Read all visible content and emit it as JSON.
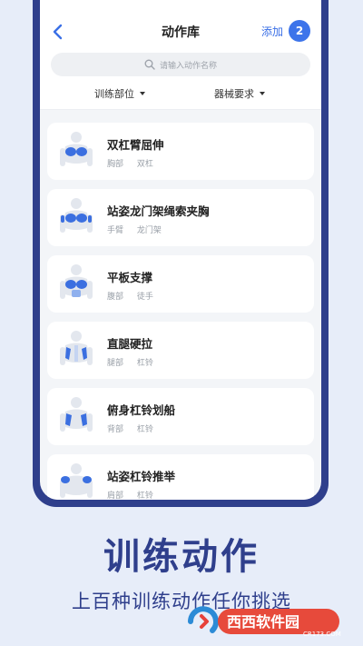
{
  "header": {
    "title": "动作库",
    "add_label": "添加",
    "badge_count": "2"
  },
  "search": {
    "placeholder": "请输入动作名称"
  },
  "filters": [
    {
      "label": "训练部位"
    },
    {
      "label": "器械要求"
    }
  ],
  "exercises": [
    {
      "name": "双杠臂屈伸",
      "tags": [
        "胸部",
        "双杠"
      ]
    },
    {
      "name": "站姿龙门架绳索夹胸",
      "tags": [
        "手臂",
        "龙门架"
      ]
    },
    {
      "name": "平板支撑",
      "tags": [
        "腹部",
        "徒手"
      ]
    },
    {
      "name": "直腿硬拉",
      "tags": [
        "腿部",
        "杠铃"
      ]
    },
    {
      "name": "俯身杠铃划船",
      "tags": [
        "背部",
        "杠铃"
      ]
    },
    {
      "name": "站姿杠铃推举",
      "tags": [
        "肩部",
        "杠铃"
      ]
    }
  ],
  "promo": {
    "headline": "训练动作",
    "subline": "上百种训练动作任你挑选"
  },
  "watermark": {
    "text": "西西软件园",
    "url": "CR173.COM"
  },
  "colors": {
    "accent": "#3d74ea",
    "brand": "#2f3f8c",
    "muscle": "#3b6fe0"
  }
}
